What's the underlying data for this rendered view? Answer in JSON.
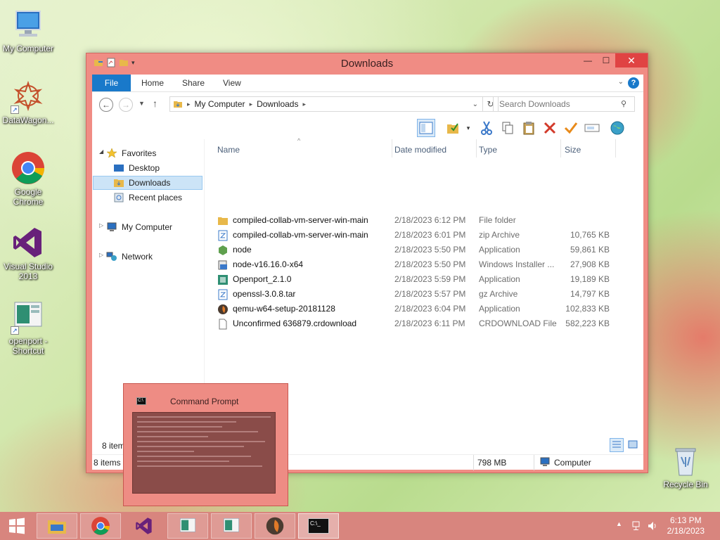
{
  "desktop": {
    "icons": [
      {
        "label": "My Computer",
        "icon": "computer-icon"
      },
      {
        "label": "DataWagon...",
        "icon": "datawagon-icon"
      },
      {
        "label": "Google Chrome",
        "icon": "chrome-icon"
      },
      {
        "label": "Visual Studio 2013",
        "icon": "visual-studio-icon"
      },
      {
        "label": "openport - Shortcut",
        "icon": "openport-icon"
      },
      {
        "label": "Recycle Bin",
        "icon": "recycle-bin-icon"
      }
    ]
  },
  "window": {
    "title": "Downloads",
    "buttons": {
      "minimize": "—",
      "maximize": "☐",
      "close": "✕"
    },
    "tabs": {
      "file": "File",
      "home": "Home",
      "share": "Share",
      "view": "View"
    },
    "address": {
      "path": [
        "My Computer",
        "Downloads"
      ]
    },
    "search_placeholder": "Search Downloads",
    "nav": {
      "favorites": "Favorites",
      "desktop": "Desktop",
      "downloads": "Downloads",
      "recent": "Recent places",
      "computer": "My Computer",
      "network": "Network"
    },
    "columns": {
      "name": "Name",
      "date": "Date modified",
      "type": "Type",
      "size": "Size"
    },
    "files": [
      {
        "name": "compiled-collab-vm-server-win-main",
        "date": "2/18/2023 6:12 PM",
        "type": "File folder",
        "size": "",
        "icon": "folder-icon"
      },
      {
        "name": "compiled-collab-vm-server-win-main",
        "date": "2/18/2023 6:01 PM",
        "type": "zip Archive",
        "size": "10,765 KB",
        "icon": "zip-icon"
      },
      {
        "name": "node",
        "date": "2/18/2023 5:50 PM",
        "type": "Application",
        "size": "59,861 KB",
        "icon": "node-icon"
      },
      {
        "name": "node-v16.16.0-x64",
        "date": "2/18/2023 5:50 PM",
        "type": "Windows Installer ...",
        "size": "27,908 KB",
        "icon": "installer-icon"
      },
      {
        "name": "Openport_2.1.0",
        "date": "2/18/2023 5:59 PM",
        "type": "Application",
        "size": "19,189 KB",
        "icon": "openport-icon"
      },
      {
        "name": "openssl-3.0.8.tar",
        "date": "2/18/2023 5:57 PM",
        "type": "gz Archive",
        "size": "14,797 KB",
        "icon": "archive-icon"
      },
      {
        "name": "qemu-w64-setup-20181128",
        "date": "2/18/2023 6:04 PM",
        "type": "Application",
        "size": "102,833 KB",
        "icon": "qemu-icon"
      },
      {
        "name": "Unconfirmed 636879.crdownload",
        "date": "2/18/2023 6:11 PM",
        "type": "CRDOWNLOAD File",
        "size": "582,223 KB",
        "icon": "file-icon"
      }
    ],
    "item_count": "8 items",
    "status": {
      "items": "8 items",
      "free": "798 MB",
      "location": "Computer"
    }
  },
  "cmd_thumbnail": {
    "title": "Command Prompt"
  },
  "taskbar": {
    "time": "6:13 PM",
    "date": "2/18/2023"
  },
  "colors": {
    "accent": "#1979ca",
    "window_frame": "#f08c84",
    "taskbar": "#d8857e"
  }
}
